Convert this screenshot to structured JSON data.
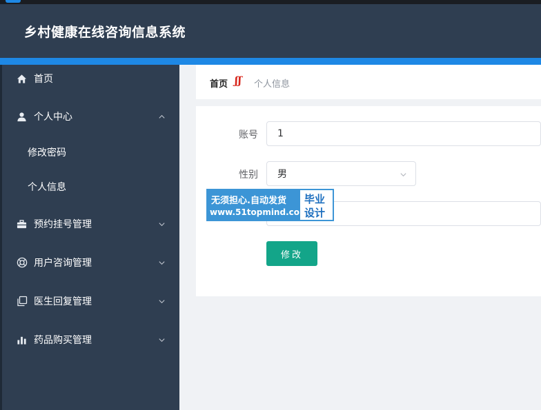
{
  "app": {
    "title": "乡村健康在线咨询信息系统"
  },
  "sidebar": {
    "items": [
      {
        "label": "首页",
        "icon": "home-icon"
      },
      {
        "label": "个人中心",
        "icon": "user-icon",
        "expanded": true,
        "children": [
          {
            "label": "修改密码"
          },
          {
            "label": "个人信息"
          }
        ]
      },
      {
        "label": "预约挂号管理",
        "icon": "briefcase-icon"
      },
      {
        "label": "用户咨询管理",
        "icon": "lifebuoy-icon"
      },
      {
        "label": "医生回复管理",
        "icon": "copy-icon"
      },
      {
        "label": "药品购买管理",
        "icon": "bar-chart-icon"
      }
    ]
  },
  "breadcrumb": {
    "home": "首页",
    "current": "个人信息"
  },
  "form": {
    "account_label": "账号",
    "account_value": "1",
    "gender_label": "性别",
    "gender_value": "男",
    "submit_label": "修改"
  },
  "watermark": {
    "line1": "无须担心.自动发货",
    "line2": "www.51topmind.com",
    "badge_line1": "毕业",
    "badge_line2": "设计"
  },
  "colors": {
    "sidebar_bg": "#2f3e51",
    "accent_blue": "#1e88e5",
    "submit_green": "#13a589",
    "breadcrumb_sep": "#d7261c"
  }
}
